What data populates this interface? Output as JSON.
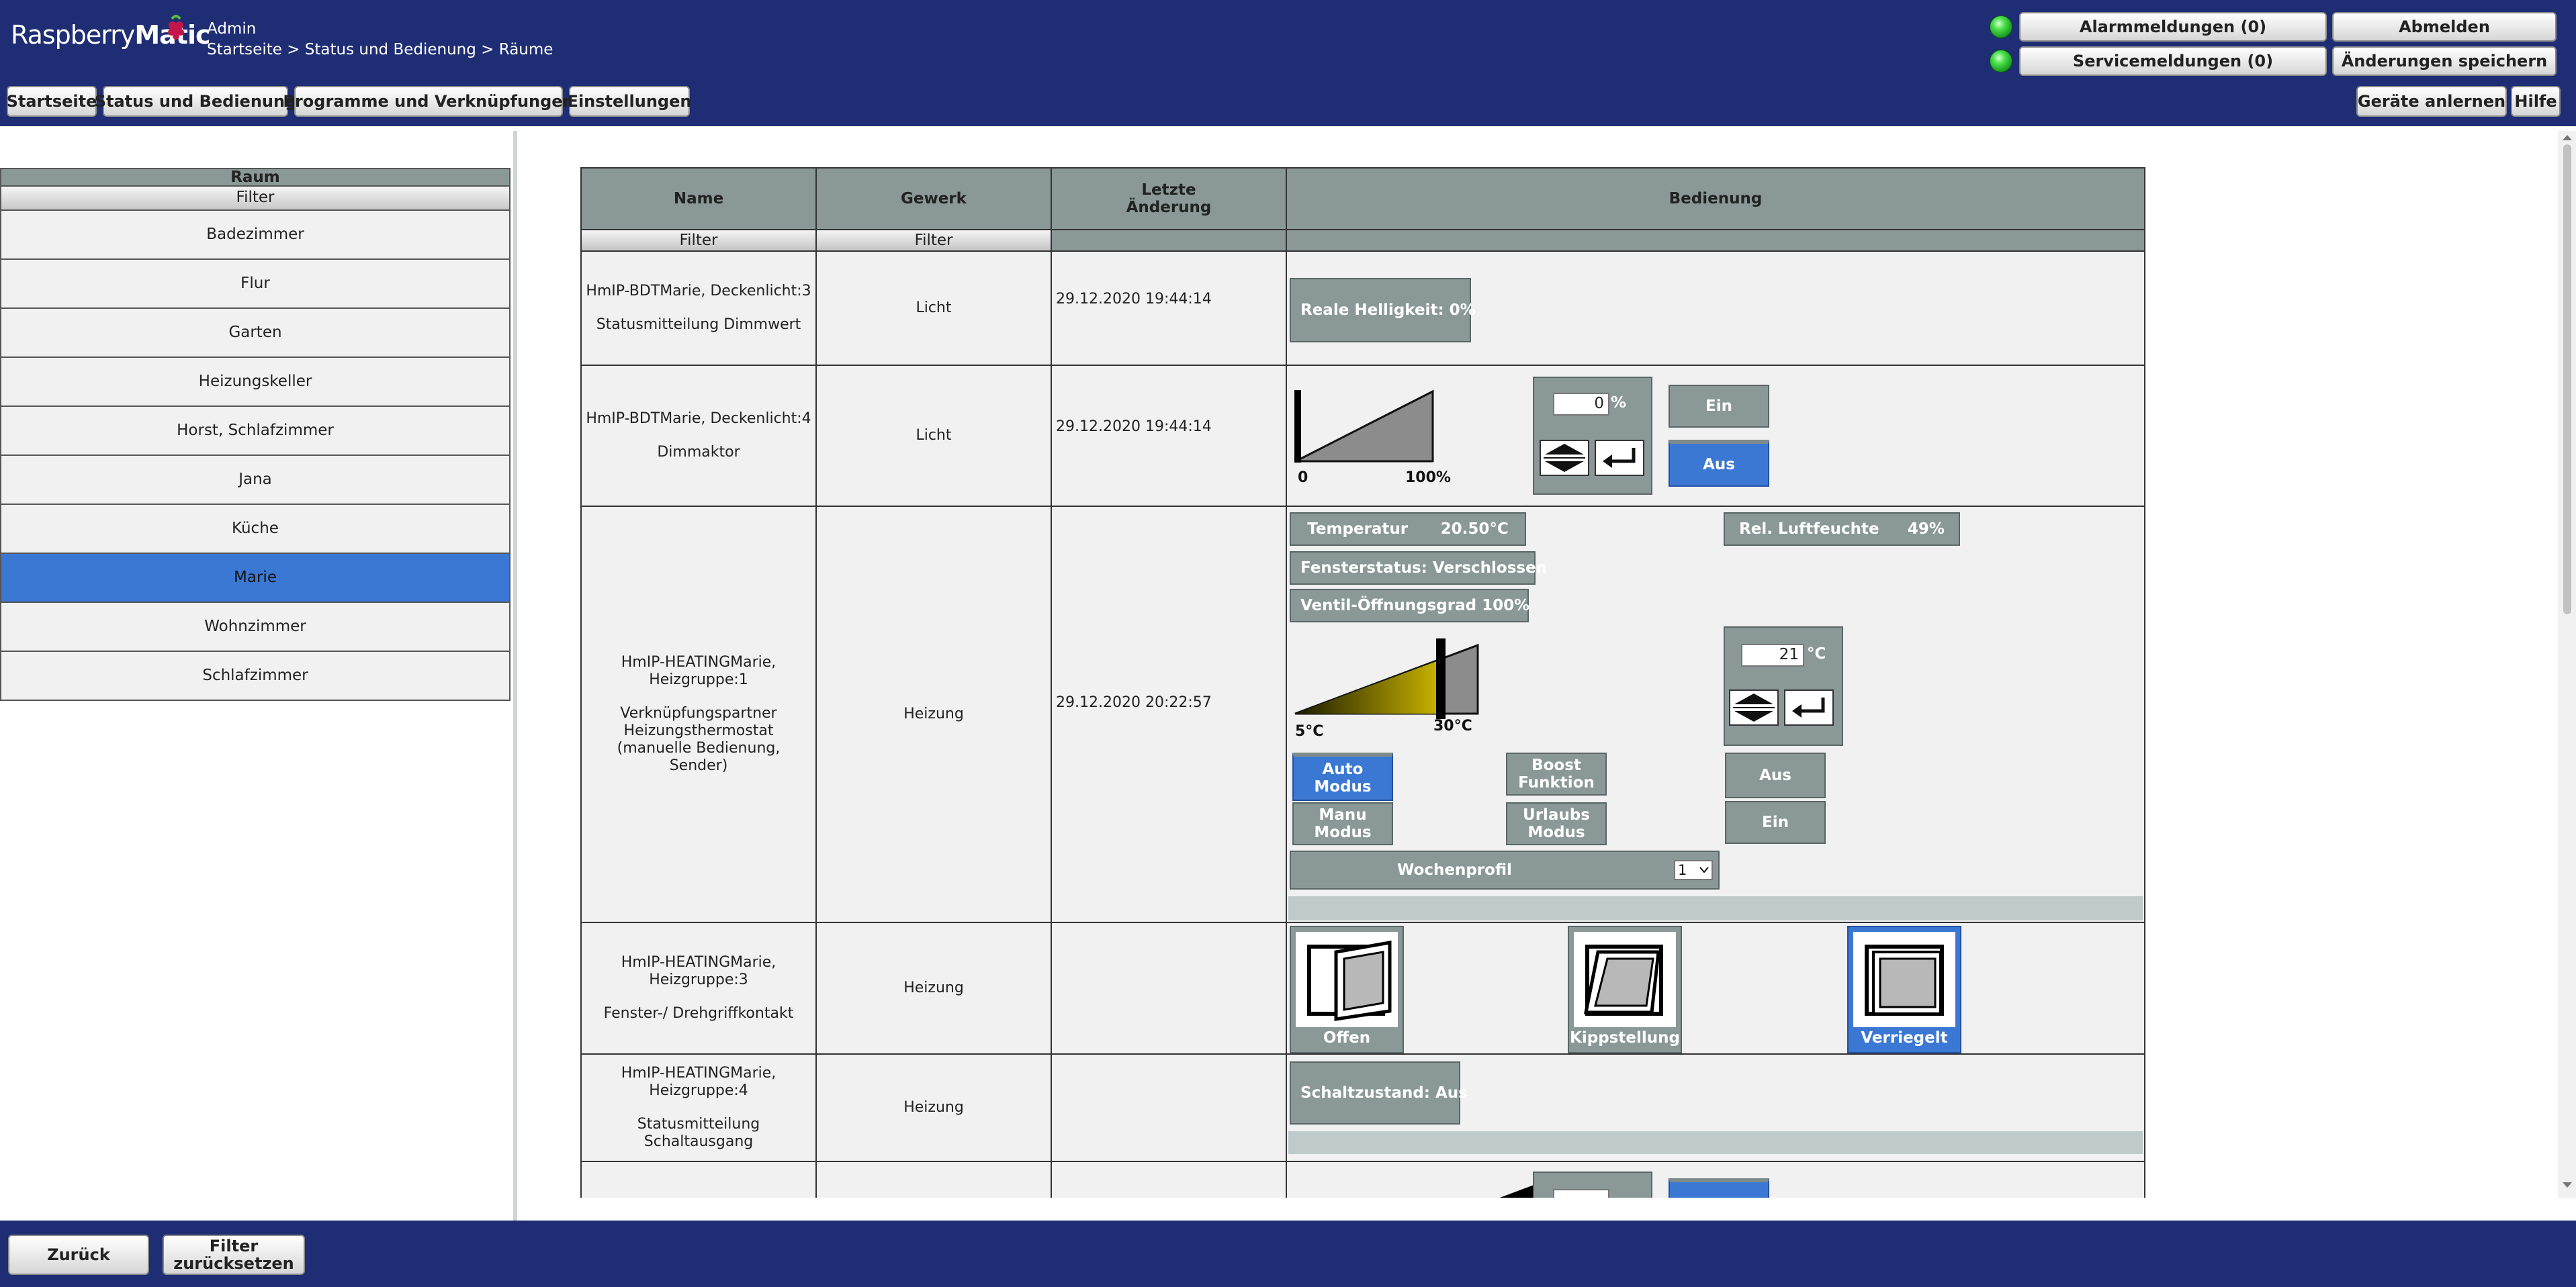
{
  "header": {
    "logo_part1": "Raspberry",
    "logo_part2": "Matic",
    "user": "Admin",
    "breadcrumb": "Startseite > Status und Bedienung > Räume",
    "alarm_label": "Alarmmeldungen (0)",
    "service_label": "Servicemeldungen (0)",
    "logout_label": "Abmelden",
    "save_label": "Änderungen speichern",
    "nav": [
      "Startseite",
      "Status und Bedienung",
      "Programme und Verknüpfungen",
      "Einstellungen"
    ],
    "teach_label": "Geräte anlernen",
    "help_label": "Hilfe"
  },
  "sidebar": {
    "header": "Raum",
    "filter": "Filter",
    "rooms": [
      "Badezimmer",
      "Flur",
      "Garten",
      "Heizungskeller",
      "Horst, Schlafzimmer",
      "Jana",
      "Küche",
      "Marie",
      "Wohnzimmer",
      "Schlafzimmer"
    ],
    "active_room": "Marie"
  },
  "table": {
    "columns": [
      "Name",
      "Gewerk",
      "Letzte\nÄnderung",
      "Bedienung"
    ],
    "filter": "Filter",
    "rows": [
      {
        "name": "HmIP-BDTMarie, Deckenlicht:3",
        "desc": "Statusmitteilung Dimmwert",
        "trade": "Licht",
        "changed": "29.12.2020 19:44:14"
      },
      {
        "name": "HmIP-BDTMarie, Deckenlicht:4",
        "desc": "Dimmaktor",
        "trade": "Licht",
        "changed": "29.12.2020 19:44:14"
      },
      {
        "name": "HmIP-HEATINGMarie, Heizgruppe:1",
        "desc": "Verknüpfungspartner Heizungsthermostat (manuelle Bedienung, Sender)",
        "trade": "Heizung",
        "changed": "29.12.2020 20:22:57"
      },
      {
        "name": "HmIP-HEATINGMarie, Heizgruppe:3",
        "desc": "Fenster-/ Drehgriffkontakt",
        "trade": "Heizung",
        "changed": ""
      },
      {
        "name": "HmIP-HEATINGMarie, Heizgruppe:4",
        "desc": "Statusmitteilung Schaltausgang",
        "trade": "Heizung",
        "changed": ""
      }
    ]
  },
  "controls": {
    "real_brightness": "Reale Helligkeit: 0%",
    "dim_value": "0",
    "dim_unit": "%",
    "dim_min": "0",
    "dim_max": "100%",
    "on_label": "Ein",
    "off_label": "Aus",
    "temp_label": "Temperatur",
    "temp_value": "20.50°C",
    "humidity_label": "Rel. Luftfeuchte",
    "humidity_value": "49%",
    "window_status": "Fensterstatus: Verschlossen",
    "valve": "Ventil-Öffnungsgrad 100%",
    "temp_min": "5°C",
    "temp_max": "30°C",
    "setpoint": "21",
    "setpoint_unit": "°C",
    "auto_mode": "Auto\nModus",
    "manual_mode": "Manu\nModus",
    "boost": "Boost\nFunktion",
    "holiday": "Urlaubs\nModus",
    "heat_off": "Aus",
    "heat_on": "Ein",
    "week_profile_label": "Wochenprofil",
    "week_profile_value": "1",
    "window_open": "Offen",
    "window_tilt": "Kippstellung",
    "window_locked": "Verriegelt",
    "switch_state": "Schaltzustand: Aus"
  },
  "footer": {
    "back_label": "Zurück",
    "reset_filter_label": "Filter\nzurücksetzen"
  },
  "colors": {
    "header_bg": "#1e2d74",
    "tile_gray": "#8a9898",
    "active_blue": "#3b78d4"
  }
}
